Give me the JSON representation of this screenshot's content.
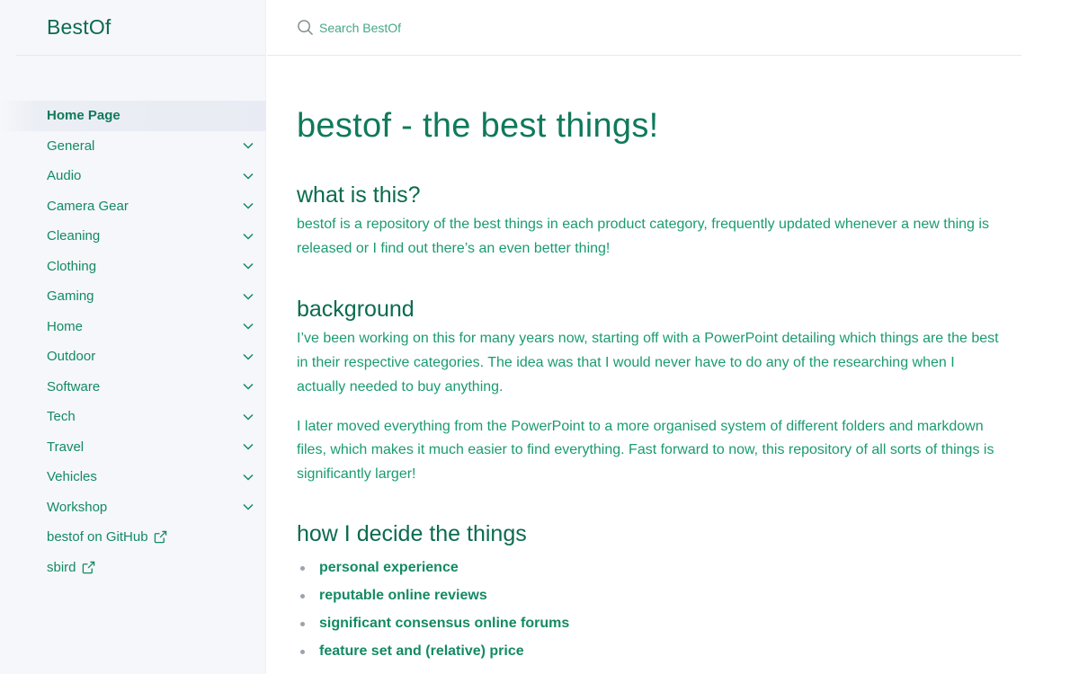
{
  "site": {
    "title": "BestOf"
  },
  "search": {
    "placeholder": "Search BestOf"
  },
  "sidebar": {
    "items": [
      {
        "label": "Home Page",
        "active": true,
        "expandable": false
      },
      {
        "label": "General",
        "expandable": true
      },
      {
        "label": "Audio",
        "expandable": true
      },
      {
        "label": "Camera Gear",
        "expandable": true
      },
      {
        "label": "Cleaning",
        "expandable": true
      },
      {
        "label": "Clothing",
        "expandable": true
      },
      {
        "label": "Gaming",
        "expandable": true
      },
      {
        "label": "Home",
        "expandable": true
      },
      {
        "label": "Outdoor",
        "expandable": true
      },
      {
        "label": "Software",
        "expandable": true
      },
      {
        "label": "Tech",
        "expandable": true
      },
      {
        "label": "Travel",
        "expandable": true
      },
      {
        "label": "Vehicles",
        "expandable": true
      },
      {
        "label": "Workshop",
        "expandable": true
      }
    ],
    "external_links": [
      {
        "label": "bestof on GitHub",
        "icon": "external-link-icon"
      },
      {
        "label": "sbird",
        "icon": "external-link-icon"
      }
    ]
  },
  "main": {
    "title": "bestof - the best things!",
    "sections": {
      "what": {
        "heading": "what is this?",
        "text": "bestof is a repository of the best things in each product category, frequently updated whenever a new thing is released or I find out there’s an even better thing!"
      },
      "background": {
        "heading": "background",
        "p1": "I’ve been working on this for many years now, starting off with a PowerPoint detailing which things are the best in their respective categories. The idea was that I would never have to do any of the researching when I actually needed to buy anything.",
        "p2": "I later moved everything from the PowerPoint to a more organised system of different folders and markdown files, which makes it much easier to find everything. Fast forward to now, this repository of all sorts of things is significantly larger!"
      },
      "how": {
        "heading": "how I decide the things",
        "criteria": [
          "personal experience",
          "reputable online reviews",
          "significant consensus online forums",
          "feature set and (relative) price"
        ]
      }
    }
  },
  "colors": {
    "accent": "#0f7a5a",
    "link": "#138a64",
    "sidebar_bg": "#f6f7fa",
    "divider": "#e6e8ec"
  }
}
